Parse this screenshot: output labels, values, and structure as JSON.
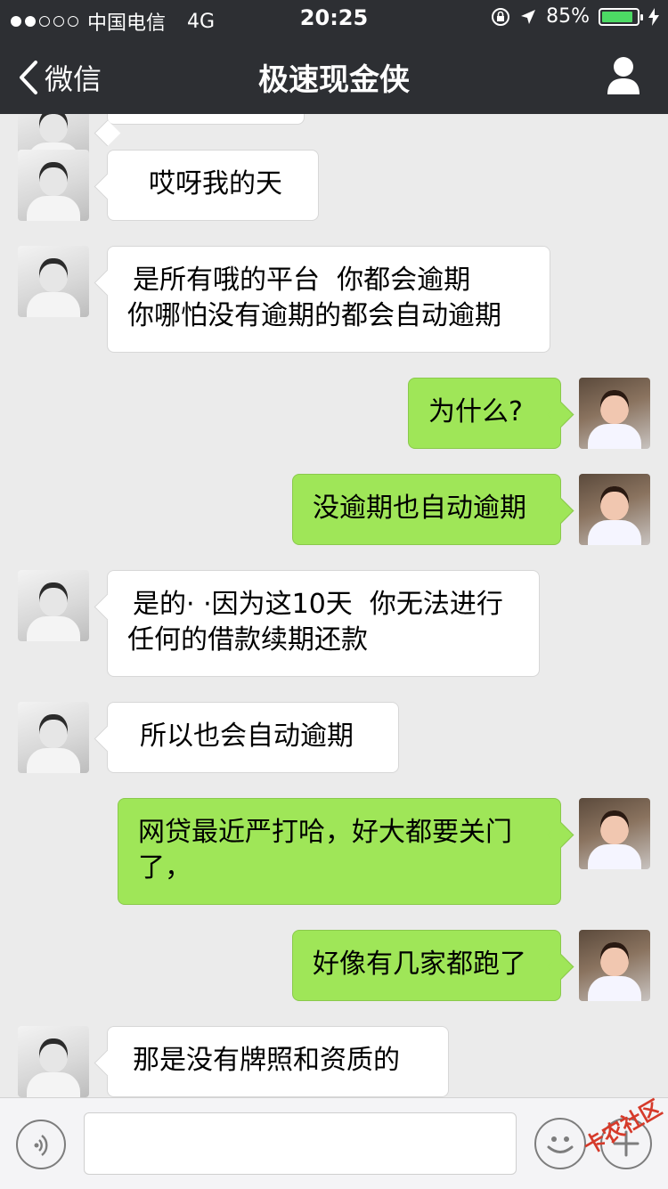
{
  "status_bar": {
    "carrier": "中国电信",
    "network": "4G",
    "time": "20:25",
    "battery": "85%"
  },
  "nav": {
    "back_label": "微信",
    "title": "极速现金侠"
  },
  "messages": [
    {
      "side": "left",
      "lines": [
        "哎呀我的天"
      ]
    },
    {
      "side": "left",
      "lines": [
        "是所有哦的平台  你都会逾期",
        "你哪怕没有逾期的都会自动逾期"
      ]
    },
    {
      "side": "right",
      "lines": [
        "为什么?"
      ]
    },
    {
      "side": "right",
      "lines": [
        "没逾期也自动逾期"
      ]
    },
    {
      "side": "left",
      "lines": [
        "是的· ·因为这10天  你无法进行",
        "任何的借款续期还款"
      ]
    },
    {
      "side": "left",
      "lines": [
        "所以也会自动逾期"
      ]
    },
    {
      "side": "right",
      "lines": [
        "网贷最近严打哈，好大都要关门",
        "了，"
      ]
    },
    {
      "side": "right",
      "lines": [
        "好像有几家都跑了"
      ]
    },
    {
      "side": "left",
      "lines": [
        "那是没有牌照和资质的"
      ]
    }
  ],
  "watermark": "卡农社区",
  "colors": {
    "nav_bg": "#2d2f33",
    "chat_bg": "#ebebeb",
    "right_bubble": "#9fe658",
    "left_bubble": "#ffffff"
  }
}
